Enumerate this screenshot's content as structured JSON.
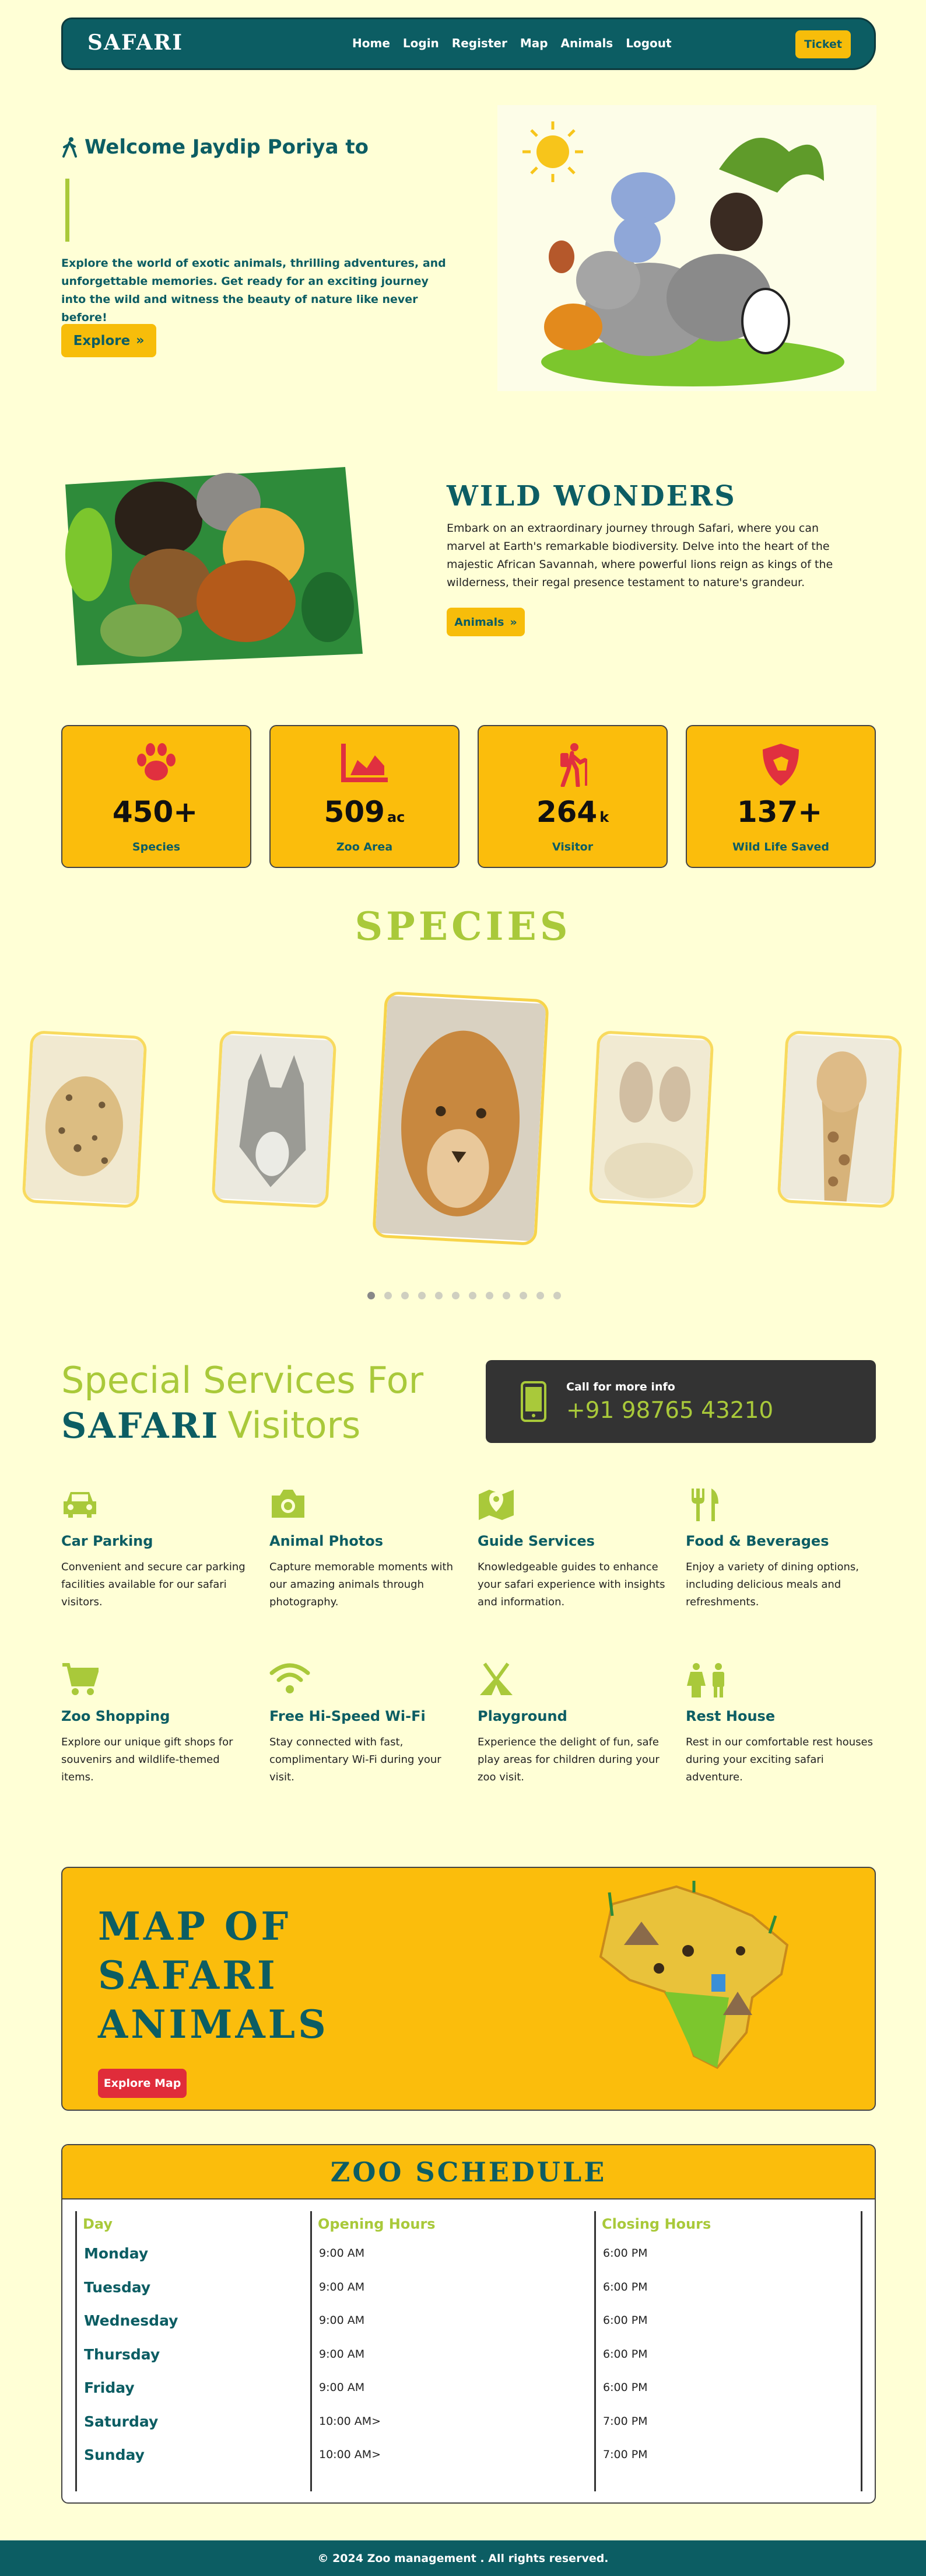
{
  "colors": {
    "teal": "#0c5d63",
    "yellow": "#fbbd0c",
    "green": "#a9c93a",
    "cream": "#ffffd6",
    "red": "#e02c3a"
  },
  "nav": {
    "logo": "SAFARI",
    "links": [
      "Home",
      "Login",
      "Register",
      "Map",
      "Animals",
      "Logout"
    ],
    "ticket": "Ticket"
  },
  "hero": {
    "welcome": "Welcome Jaydip Poriya to",
    "text": "Explore the world of exotic animals, thrilling adventures, and unforgettable memories. Get ready for an exciting journey into the wild and witness the beauty of nature like never before!",
    "explore": "Explore"
  },
  "wild": {
    "title": "WILD WONDERS",
    "text": "Embark on an extraordinary journey through Safari, where you can marvel at Earth's remarkable biodiversity. Delve into the heart of the majestic African Savannah, where powerful lions reign as kings of the wilderness, their regal presence testament to nature's grandeur.",
    "button": "Animals"
  },
  "stats": [
    {
      "icon": "paw-icon",
      "num": "450+",
      "unit": "",
      "label": "Species"
    },
    {
      "icon": "area-chart-icon",
      "num": "509",
      "unit": "ac",
      "label": "Zoo Area"
    },
    {
      "icon": "hiker-icon",
      "num": "264",
      "unit": "k",
      "label": "Visitor"
    },
    {
      "icon": "shield-dog-icon",
      "num": "137+",
      "unit": "",
      "label": "Wild Life Saved"
    }
  ],
  "species": {
    "title": "SPECIES",
    "cards": [
      "leopard",
      "wolf",
      "lioness",
      "deer",
      "giraffe"
    ],
    "dots": 12,
    "active_dot": 0
  },
  "services": {
    "line1": "Special Services For",
    "brand": "SAFARI",
    "line2": "Visitors",
    "call_label": "Call for more info",
    "phone": "+91 98765 43210",
    "items": [
      {
        "icon": "car-icon",
        "title": "Car Parking",
        "text": "Convenient and secure car parking facilities available for our safari visitors."
      },
      {
        "icon": "camera-icon",
        "title": "Animal Photos",
        "text": "Capture memorable moments with our amazing animals through photography."
      },
      {
        "icon": "map-pin-icon",
        "title": "Guide Services",
        "text": "Knowledgeable guides to enhance your safari experience with insights and information."
      },
      {
        "icon": "utensils-icon",
        "title": "Food & Beverages",
        "text": "Enjoy a variety of dining options, including delicious meals and refreshments."
      },
      {
        "icon": "cart-icon",
        "title": "Zoo Shopping",
        "text": "Explore our unique gift shops for souvenirs and wildlife-themed items."
      },
      {
        "icon": "wifi-icon",
        "title": "Free Hi-Speed Wi-Fi",
        "text": "Stay connected with fast, complimentary Wi-Fi during your visit."
      },
      {
        "icon": "tent-icon",
        "title": "Playground",
        "text": "Experience the delight of fun, safe play areas for children during your zoo visit."
      },
      {
        "icon": "restroom-icon",
        "title": "Rest House",
        "text": "Rest in our comfortable rest houses during your exciting safari adventure."
      }
    ]
  },
  "map": {
    "title_lines": [
      "MAP OF",
      "SAFARI",
      "ANIMALS"
    ],
    "button": "Explore Map"
  },
  "schedule": {
    "title": "ZOO SCHEDULE",
    "headers": [
      "Day",
      "Opening Hours",
      "Closing Hours"
    ],
    "days": [
      "Monday",
      "Tuesday",
      "Wednesday",
      "Thursday",
      "Friday",
      "Saturday",
      "Sunday"
    ],
    "open": [
      "9:00 AM",
      "9:00 AM",
      "9:00 AM",
      "9:00 AM",
      "9:00 AM",
      "10:00 AM>",
      "10:00 AM>"
    ],
    "close": [
      "6:00 PM",
      "6:00 PM",
      "6:00 PM",
      "6:00 PM",
      "6:00 PM",
      "7:00 PM",
      "7:00 PM"
    ]
  },
  "footer": "© 2024 Zoo management . All rights reserved."
}
